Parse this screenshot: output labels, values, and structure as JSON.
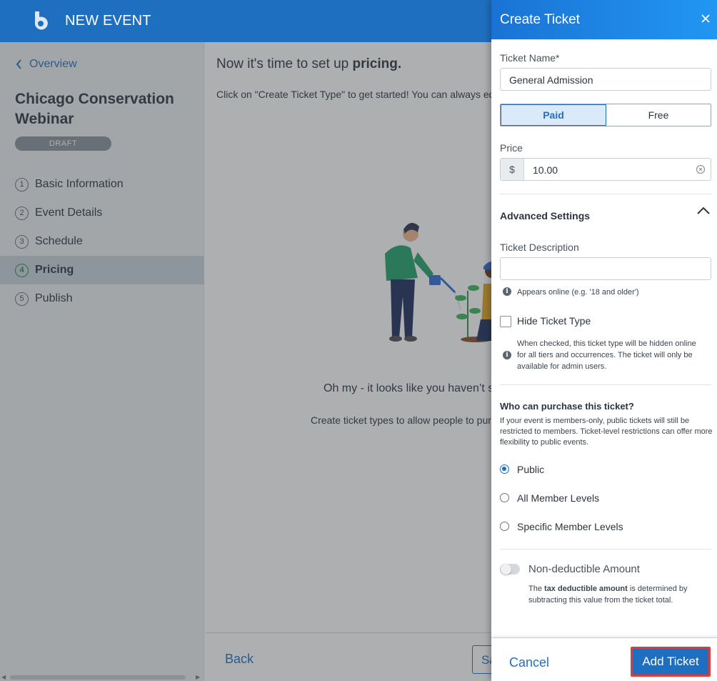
{
  "topbar": {
    "title": "NEW EVENT",
    "logo_icon": "brand-logo-icon"
  },
  "sidebar": {
    "back_label": "Overview",
    "event_name": "Chicago Conservation Webinar",
    "status_badge": "DRAFT",
    "steps": [
      {
        "num": "1",
        "label": "Basic Information",
        "active": false
      },
      {
        "num": "2",
        "label": "Event Details",
        "active": false
      },
      {
        "num": "3",
        "label": "Schedule",
        "active": false
      },
      {
        "num": "4",
        "label": "Pricing",
        "active": true
      },
      {
        "num": "5",
        "label": "Publish",
        "active": false
      }
    ]
  },
  "main": {
    "heading_prefix": "Now it's time to set up",
    "heading_bold": "pricing.",
    "intro": "Click on \"Create Ticket Type\" to get started! You can always edit this later to fit your event.",
    "empty_title": "Oh my - it looks like you haven’t set up any tickets yet.",
    "empty_sub": "Create ticket types to allow people to purchase tickets.",
    "back_label": "Back",
    "save_label": "Save"
  },
  "drawer": {
    "title": "Create Ticket",
    "ticket_name_label": "Ticket Name*",
    "ticket_name_value": "General Admission",
    "paid_label": "Paid",
    "free_label": "Free",
    "selected_pricing": "Paid",
    "price_label": "Price",
    "currency_symbol": "$",
    "price_value": "10.00",
    "advanced_title": "Advanced Settings",
    "description_label": "Ticket Description",
    "description_value": "",
    "description_hint": "Appears online (e.g. '18 and older')",
    "hide_label": "Hide Ticket Type",
    "hide_checked": false,
    "hide_hint": "When checked, this ticket type will be hidden online for all tiers and occurrences. The ticket will only be available for admin users.",
    "who_title": "Who can purchase this ticket?",
    "who_desc": "If your event is members-only, public tickets will still be restricted to members. Ticket-level restrictions can offer more flexibility to public events.",
    "options": [
      {
        "label": "Public",
        "selected": true
      },
      {
        "label": "All Member Levels",
        "selected": false
      },
      {
        "label": "Specific Member Levels",
        "selected": false
      }
    ],
    "nondeductible_label": "Non-deductible Amount",
    "nondeductible_on": false,
    "tax_hint_prefix": "The",
    "tax_hint_bold": "tax deductible amount",
    "tax_hint_suffix": "is determined by subtracting this value from the ticket total.",
    "cancel_label": "Cancel",
    "add_label": "Add Ticket"
  },
  "colors": {
    "brand": "#1f6fc0",
    "highlight_border": "#e53935",
    "active_step": "#2e8b3a"
  }
}
